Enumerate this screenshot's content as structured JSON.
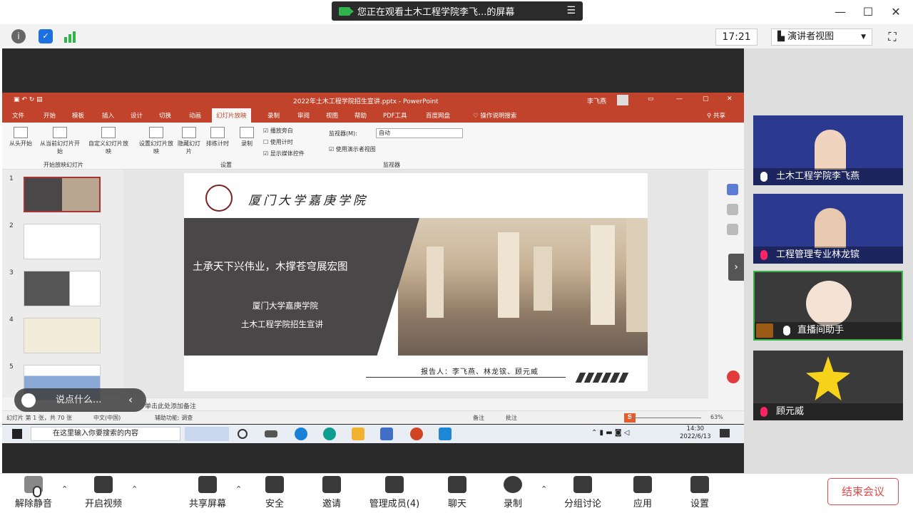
{
  "banner": {
    "text": "您正在观看土木工程学院李飞...的屏幕",
    "menu_icon": "list-menu-icon"
  },
  "status": {
    "time": "17:21",
    "view_mode": "演讲者视图"
  },
  "ppt": {
    "window_title": "2022年土木工程学院招生宣讲.pptx - PowerPoint",
    "user": "李飞燕",
    "share_label": "共享",
    "menu": [
      "文件",
      "开始",
      "模板",
      "插入",
      "设计",
      "切换",
      "动画",
      "幻灯片放映",
      "录制",
      "审阅",
      "视图",
      "帮助",
      "PDF工具",
      "百度网盘",
      "操作说明搜索"
    ],
    "ribbon": {
      "from_start": "从头开始",
      "from_current": "从当前幻灯片开始",
      "custom": "自定义幻灯片放映",
      "setup": "设置幻灯片放映",
      "hide": "隐藏幻灯片",
      "rehearse": "排练计时",
      "record": "录制",
      "chk_narration": "播放旁白",
      "chk_timing": "使用计时",
      "chk_media": "显示媒体控件",
      "monitor_label": "监视器(M):",
      "monitor_value": "自动",
      "presenter_view": "使用演示者视图",
      "group_start": "开始放映幻灯片",
      "group_setup": "设置",
      "group_monitor": "监视器"
    },
    "thumb_numbers": [
      "1",
      "2",
      "3",
      "4",
      "5"
    ],
    "slide": {
      "school": "厦门大学嘉庚学院",
      "slogan": "土承天下兴伟业，木撑苍穹展宏图",
      "sub1": "厦门大学嘉庚学院",
      "sub2": "土木工程学院招生宣讲",
      "reporter": "报告人：李飞燕、林龙镔、顾元威"
    },
    "notes_placeholder": "单击此处添加备注",
    "status_left": "幻灯片 第 1 张，共 70 张",
    "status_lang": "中文(中国)",
    "status_access": "辅助功能: 调查",
    "status_notes": "备注",
    "status_comments": "批注",
    "zoom": "63%"
  },
  "taskbar": {
    "search_placeholder": "在这里输入你要搜索的内容",
    "time": "14:30",
    "date": "2022/6/13"
  },
  "chat": {
    "placeholder": "说点什么..."
  },
  "participants": [
    {
      "name": "土木工程学院李飞燕",
      "mic": "mic-on"
    },
    {
      "name": "工程管理专业林龙镔",
      "mic": "mic-muted"
    },
    {
      "name": "直播间助手",
      "mic": "mic-on"
    },
    {
      "name": "顾元威",
      "mic": "mic-muted"
    }
  ],
  "toolbar": {
    "unmute": "解除静音",
    "video": "开启视频",
    "share": "共享屏幕",
    "security": "安全",
    "invite": "邀请",
    "members": "管理成员(4)",
    "chat": "聊天",
    "record": "录制",
    "breakout": "分组讨论",
    "apps": "应用",
    "settings": "设置",
    "end": "结束会议"
  },
  "colors": {
    "ppt_red": "#c1432b",
    "tile_blue": "#2b3a8f",
    "end_red": "#e04b4b",
    "green": "#2fb34a"
  }
}
